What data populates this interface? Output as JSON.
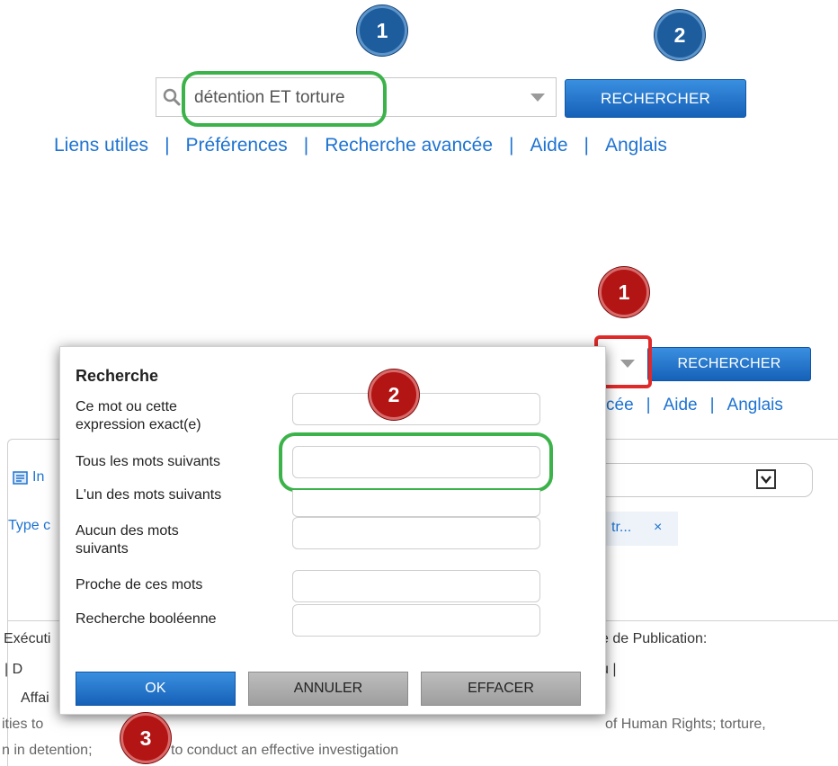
{
  "top_panel": {
    "search_value": "détention ET torture",
    "search_button": "RECHERCHER",
    "links": [
      "Liens utiles",
      "Préférences",
      "Recherche avancée",
      "Aide",
      "Anglais"
    ],
    "separator": "|",
    "badge_1": "1",
    "badge_2": "2"
  },
  "bottom_panel": {
    "search_button": "RECHERCHER",
    "links_partial": [
      "cée",
      "Aide",
      "Anglais"
    ],
    "separator": "|",
    "badge_1": "1",
    "badge_2": "2",
    "badge_3": "3",
    "background": {
      "tab_fragment": "In",
      "filter_fragment": "Type c",
      "chip_label": "tr...",
      "chip_close": "×",
      "col_left_fragment": "Exécuti",
      "col_left_row2": "|   D",
      "col_left_row3": "Affai",
      "col_right_heading": "e de Publication:",
      "col_right_row2": "u  |",
      "snippet_line1_left": "ities to",
      "snippet_line1_right": "of Human Rights; torture,",
      "snippet_line2_left": "n in detention;",
      "snippet_line2_right": "to conduct an effective investigation"
    },
    "modal": {
      "title": "Recherche",
      "fields": [
        {
          "label_lines": [
            "Ce mot ou cette",
            "expression exact(e)"
          ],
          "value": ""
        },
        {
          "label_lines": [
            "Tous les mots suivants"
          ],
          "value": ""
        },
        {
          "label_lines": [
            "L'un des mots suivants"
          ],
          "value": ""
        },
        {
          "label_lines": [
            "Aucun des mots",
            "suivants"
          ],
          "value": ""
        },
        {
          "label_lines": [
            "Proche de ces mots"
          ],
          "value": ""
        },
        {
          "label_lines": [
            "Recherche booléenne"
          ],
          "value": ""
        }
      ],
      "buttons": {
        "ok": "OK",
        "cancel": "ANNULER",
        "clear": "EFFACER"
      }
    }
  },
  "colors": {
    "link_blue": "#1e73d2",
    "button_blue": "#1561b8",
    "highlight_green": "#3cb34a",
    "highlight_red": "#e02a2a",
    "badge_blue": "#1d5d9e",
    "badge_red": "#b31414"
  }
}
